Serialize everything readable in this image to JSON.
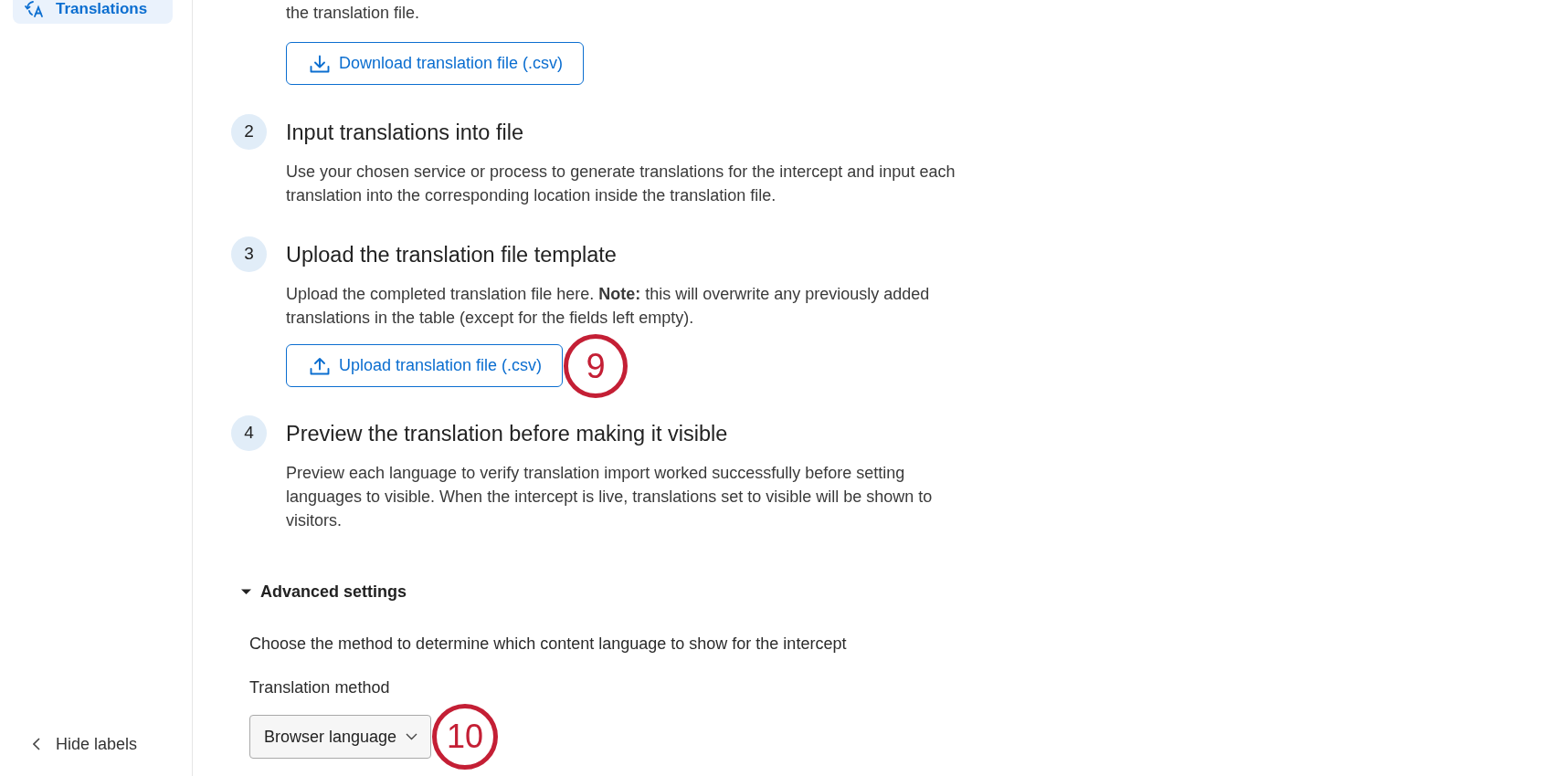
{
  "sidebar": {
    "items": [
      {
        "label": "Translations",
        "selected": true
      }
    ],
    "footer_link": {
      "label": "Hide labels"
    }
  },
  "steps": [
    {
      "description": "the translation file.",
      "button": {
        "kind": "download",
        "label": "Download translation file (.csv)"
      }
    },
    {
      "number": "2",
      "title": "Input translations into file",
      "description": "Use your chosen service or process to generate translations for the intercept and input each translation into the corresponding location inside the translation file."
    },
    {
      "number": "3",
      "title": "Upload the translation file template",
      "description": "Upload the completed translation file here. **Note:** this will overwrite any previously added translations in the table (except for the fields left empty).",
      "button": {
        "kind": "upload",
        "label": "Upload translation file (.csv)",
        "callout": "9"
      }
    },
    {
      "number": "4",
      "title": "Preview the translation before making it visible",
      "description": "Preview each language to verify translation import worked successfully before setting languages to visible. When the intercept is live, translations set to visible will be shown to visitors."
    }
  ],
  "advanced_settings": {
    "title": "Advanced settings",
    "expanded": true,
    "description": "Choose the method to determine which content language to show for the intercept",
    "field_label": "Translation method",
    "dropdown": {
      "value": "Browser language",
      "callout": "10"
    }
  }
}
